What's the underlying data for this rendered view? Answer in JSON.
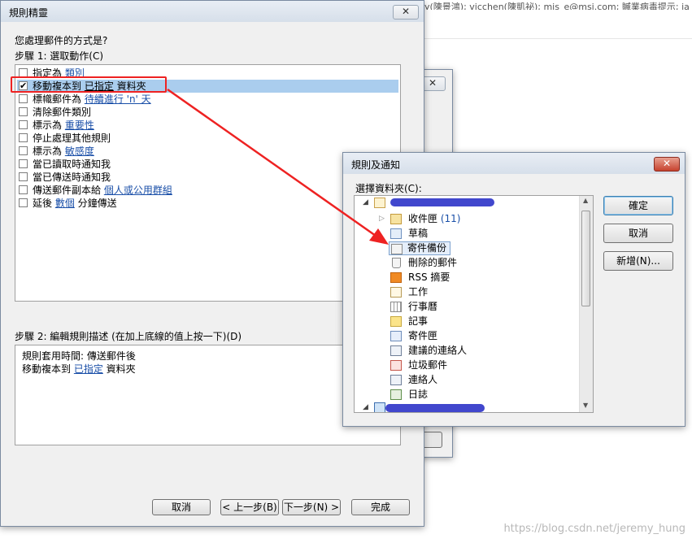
{
  "background": {
    "email_recipients": "y(陳景鴻); vicchen(陳凱祕); mis_e@msi.com; 贓業病毒提示; ja",
    "watermark": "https://blog.csdn.net/jeremy_hung"
  },
  "wizard": {
    "title": "規則精靈",
    "question": "您處理郵件的方式是?",
    "step1_label": "步驟 1: 選取動作(C)",
    "actions": [
      {
        "checked": false,
        "text": "指定為 ",
        "link": "類別",
        "after": ""
      },
      {
        "checked": true,
        "text": "移動複本到 ",
        "link": "已指定",
        "after": " 資料夾"
      },
      {
        "checked": false,
        "text": "標幟郵件為 ",
        "link": "待續進行 'n' 天",
        "after": ""
      },
      {
        "checked": false,
        "text": "清除郵件類別",
        "link": "",
        "after": ""
      },
      {
        "checked": false,
        "text": "標示為 ",
        "link": "重要性",
        "after": ""
      },
      {
        "checked": false,
        "text": "停止處理其他規則",
        "link": "",
        "after": ""
      },
      {
        "checked": false,
        "text": "標示為 ",
        "link": "敏感度",
        "after": ""
      },
      {
        "checked": false,
        "text": "當已讀取時通知我",
        "link": "",
        "after": ""
      },
      {
        "checked": false,
        "text": "當已傳送時通知我",
        "link": "",
        "after": ""
      },
      {
        "checked": false,
        "text": "傳送郵件副本給 ",
        "link": "個人或公用群組",
        "after": ""
      },
      {
        "checked": false,
        "text": "延後 ",
        "link": "數個",
        "after": " 分鐘傳送"
      }
    ],
    "step2_label": "步驟 2: 編輯規則描述 (在加上底線的值上按一下)(D)",
    "desc_line1": "規則套用時間: 傳送郵件後",
    "desc_line2_pre": "移動複本到 ",
    "desc_line2_link": "已指定",
    "desc_line2_post": " 資料夾",
    "buttons": {
      "cancel": "取消",
      "back": "< 上一步(B)",
      "next": "下一步(N) >",
      "finish": "完成"
    },
    "close_glyph": "✕"
  },
  "notify": {
    "title": "規則及通知",
    "select_label": "選擇資料夾(C):",
    "folders": [
      {
        "name": "收件匣",
        "count": "(11)",
        "icon": "inbox-icon"
      },
      {
        "name": "草稿",
        "count": "",
        "icon": "drafts-icon"
      },
      {
        "name": "寄件備份",
        "count": "",
        "icon": "sent-items-icon"
      },
      {
        "name": "刪除的郵件",
        "count": "",
        "icon": "deleted-items-icon"
      },
      {
        "name": "RSS 摘要",
        "count": "",
        "icon": "rss-icon"
      },
      {
        "name": "工作",
        "count": "",
        "icon": "tasks-icon"
      },
      {
        "name": "行事曆",
        "count": "",
        "icon": "calendar-icon"
      },
      {
        "name": "記事",
        "count": "",
        "icon": "notes-icon"
      },
      {
        "name": "寄件匣",
        "count": "",
        "icon": "outbox-icon"
      },
      {
        "name": "建議的連絡人",
        "count": "",
        "icon": "suggested-contacts-icon"
      },
      {
        "name": "垃圾郵件",
        "count": "",
        "icon": "junk-mail-icon"
      },
      {
        "name": "連絡人",
        "count": "",
        "icon": "contacts-icon"
      },
      {
        "name": "日誌",
        "count": "",
        "icon": "journal-icon"
      }
    ],
    "buttons": {
      "ok": "確定",
      "cancel": "取消",
      "new": "新增(N)..."
    },
    "close_glyph": "✕"
  },
  "colors": {
    "annotation_red": "#ee2222",
    "selection": "#aacdee",
    "link": "#1a4fa8"
  }
}
